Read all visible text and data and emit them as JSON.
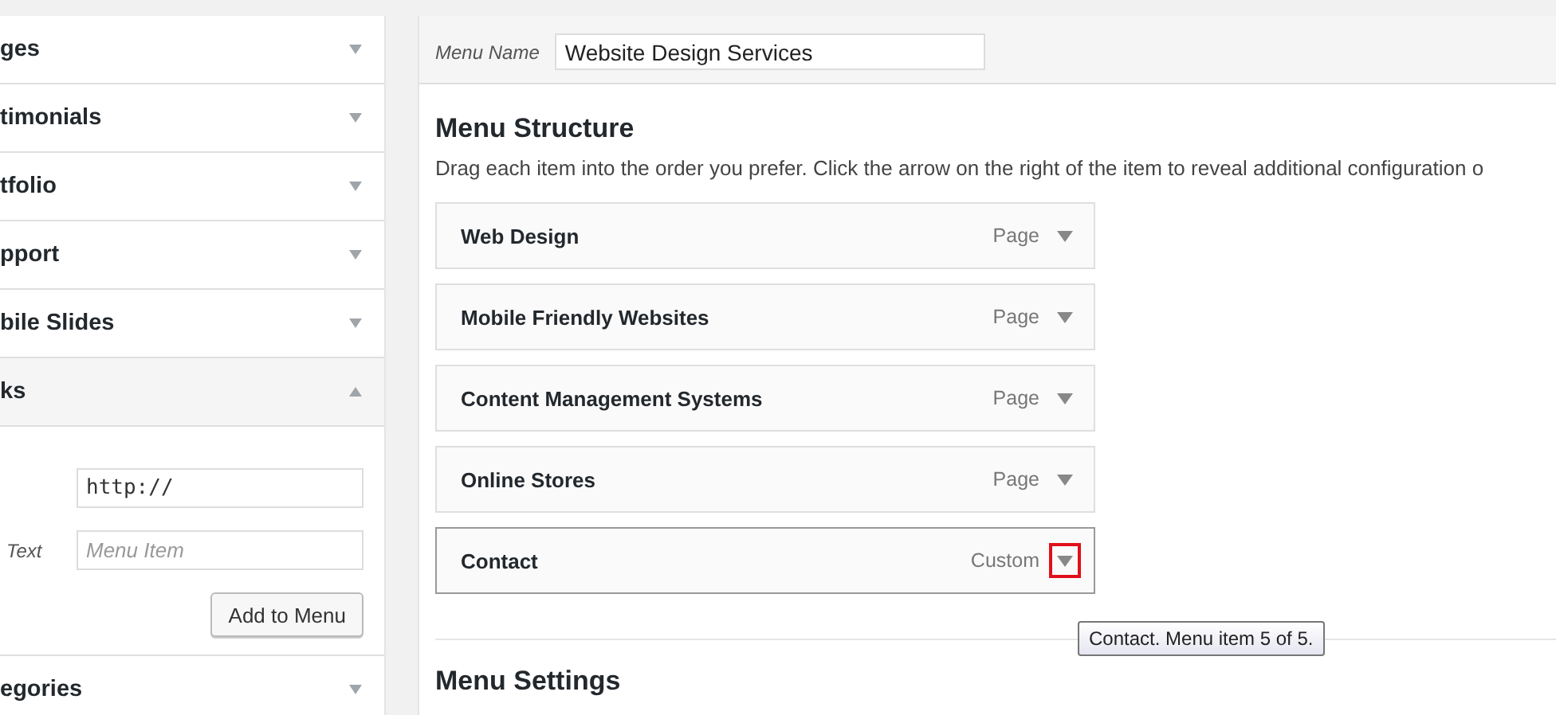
{
  "sidebar": {
    "sections": [
      {
        "title": "ges",
        "expanded": false
      },
      {
        "title": "timonials",
        "expanded": false
      },
      {
        "title": "tfolio",
        "expanded": false
      },
      {
        "title": "pport",
        "expanded": false
      },
      {
        "title": "bile Slides",
        "expanded": false
      },
      {
        "title": "ks",
        "expanded": true,
        "url_value": "http://",
        "text_label": "Text",
        "text_placeholder": "Menu Item",
        "button": "Add to Menu"
      },
      {
        "title": "egories",
        "expanded": false
      }
    ]
  },
  "menu_name": {
    "label": "Menu Name",
    "value": "Website Design Services"
  },
  "structure": {
    "title": "Menu Structure",
    "description": "Drag each item into the order you prefer. Click the arrow on the right of the item to reveal additional configuration o",
    "items": [
      {
        "title": "Web Design",
        "type": "Page",
        "focused": false
      },
      {
        "title": "Mobile Friendly Websites",
        "type": "Page",
        "focused": false
      },
      {
        "title": "Content Management Systems",
        "type": "Page",
        "focused": false
      },
      {
        "title": "Online Stores",
        "type": "Page",
        "focused": false
      },
      {
        "title": "Contact",
        "type": "Custom",
        "focused": true
      }
    ]
  },
  "tooltip": "Contact. Menu item 5 of 5.",
  "settings_title": "Menu Settings"
}
